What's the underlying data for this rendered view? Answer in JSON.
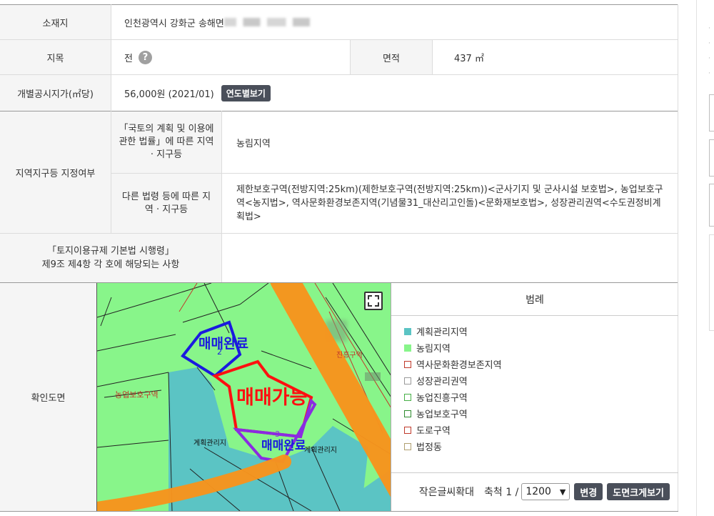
{
  "table": {
    "address_label": "소재지",
    "address_value": "인천광역시 강화군 송해면 ",
    "jimok_label": "지목",
    "jimok_value": "전",
    "help_glyph": "?",
    "area_label": "면적",
    "area_value": "437 ㎡",
    "price_label": "개별공시지가(㎡당)",
    "price_value": "56,000원 (2021/01)",
    "yearly_button": "연도별보기",
    "zone_label": "지역지구등 지정여부",
    "zone_sub1_label": "「국토의 계획 및 이용에 관한 법률」에 따른 지역 · 지구등",
    "zone_sub1_value": "농림지역",
    "zone_sub2_label": "다른 법령 등에 따른 지역 · 지구등",
    "zone_sub2_value": "제한보호구역(전방지역:25km)(제한보호구역(전방지역:25km))<군사기지 및 군사시설 보호법>, 농업보호구역<농지법>, 역사문화환경보존지역(기념물31_대산리고인돌)<문화재보호법>, 성장관리권역<수도권정비계획법>",
    "regulation_label_1": "「토지이용규제 기본법 시행령」",
    "regulation_label_2": "제9조 제4항 각 호에 해당되는 사항",
    "regulation_value": "",
    "map_label": "확인도면"
  },
  "map": {
    "overlay_sold_1": "매매완료",
    "overlay_available": "매매가능",
    "overlay_sold_2": "매매완료",
    "parcel_no_1": "2",
    "parcel_no_2": "3",
    "map_text_farm": "농업보호구역",
    "map_text_plan_1": "계획관리지",
    "map_text_plan_2": "계획관리지",
    "map_text_promo": "진흥구역",
    "colors": {
      "planning": "#5bc4c4",
      "agri_forest": "#88f58a",
      "heritage": "#c0392b",
      "growth": "#999999",
      "agri_promo": "#46b046",
      "agri_protect": "#2e8b2e",
      "road": "#c0392b",
      "legal_dong": "#b0a070",
      "sold_blue": "#1a1adf",
      "available_red": "#ff1010",
      "sold_purple": "#8a2be2",
      "orange_stroke": "#f7941d"
    }
  },
  "legend": {
    "title": "범례",
    "items": [
      {
        "label": "계획관리지역",
        "color": "#5bc4c4",
        "filled": true
      },
      {
        "label": "농림지역",
        "color": "#88f58a",
        "filled": true
      },
      {
        "label": "역사문화환경보존지역",
        "color": "#c0392b",
        "filled": false
      },
      {
        "label": "성장관리권역",
        "color": "#999999",
        "filled": false
      },
      {
        "label": "농업진흥구역",
        "color": "#46b046",
        "filled": false
      },
      {
        "label": "농업보호구역",
        "color": "#2e8b2e",
        "filled": false
      },
      {
        "label": "도로구역",
        "color": "#c0392b",
        "filled": false
      },
      {
        "label": "법정동",
        "color": "#b0a070",
        "filled": false
      }
    ]
  },
  "toolbar": {
    "small_text_zoom": "작은글씨확대",
    "scale_label": "축척 1 /",
    "scale_value": "1200",
    "change_button": "변경",
    "large_view_button": "도면크게보기"
  }
}
